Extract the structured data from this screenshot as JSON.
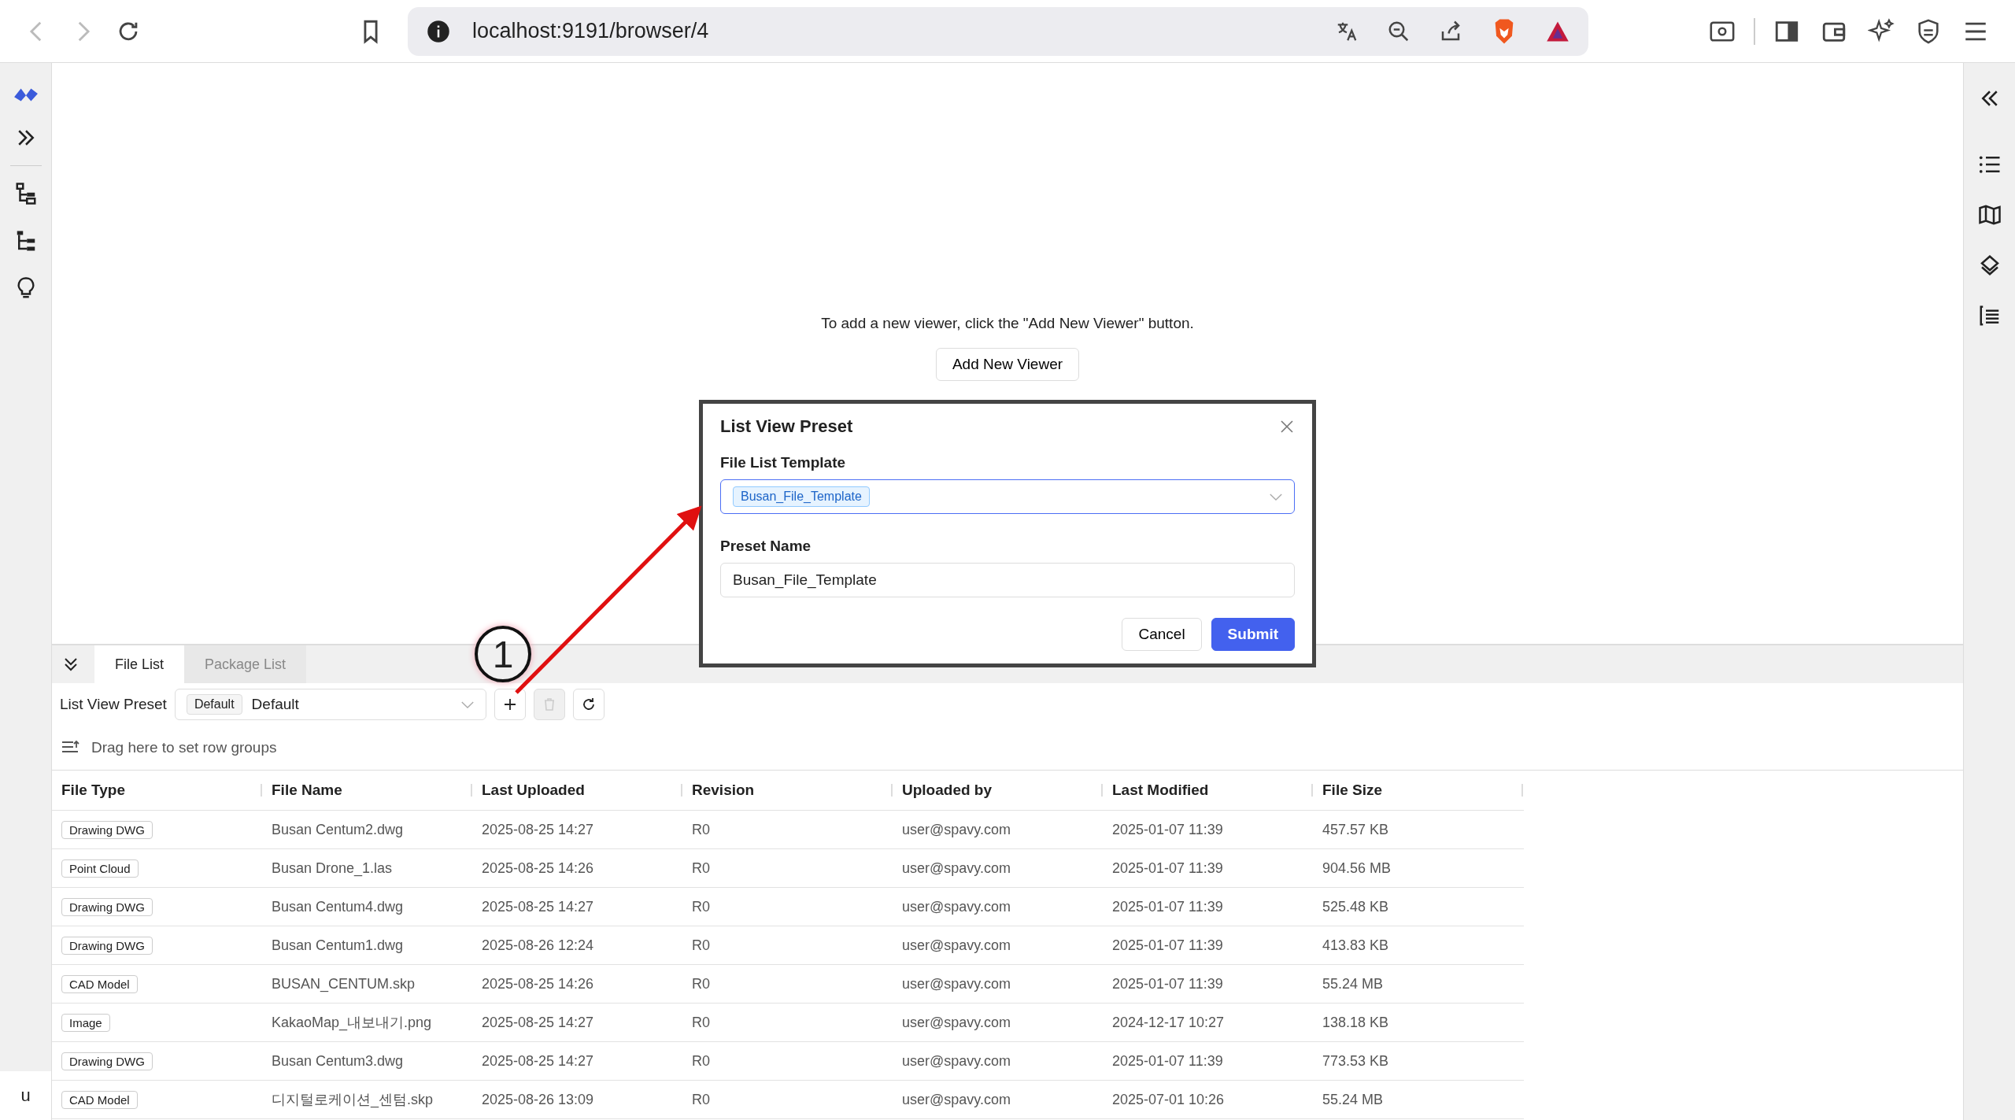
{
  "browser": {
    "url": "localhost:9191/browser/4"
  },
  "left_sidebar": {
    "footer": "u"
  },
  "viewer": {
    "message": "To add a new viewer, click the \"Add New Viewer\" button.",
    "button": "Add New Viewer"
  },
  "dialog": {
    "title": "List View Preset",
    "template_label": "File List Template",
    "template_tag": "Busan_File_Template",
    "preset_label": "Preset Name",
    "preset_value": "Busan_File_Template",
    "buttons": [
      {
        "label": "Cancel",
        "kind": "secondary"
      },
      {
        "label": "Submit",
        "kind": "primary"
      }
    ]
  },
  "tabs": [
    {
      "label": "File List",
      "selected": true
    },
    {
      "label": "Package List",
      "selected": false
    }
  ],
  "preset": {
    "label": "List View Preset",
    "tag": "Default",
    "value": "Default",
    "delete_disabled": true
  },
  "group_hint": "Drag here to set row groups",
  "table": {
    "columns": [
      "File Type",
      "File Name",
      "Last Uploaded",
      "Revision",
      "Uploaded by",
      "Last Modified",
      "File Size"
    ],
    "rows": [
      [
        "Drawing DWG",
        "Busan Centum2.dwg",
        "2025-08-25 14:27",
        "R0",
        "user@spavy.com",
        "2025-01-07 11:39",
        "457.57 KB"
      ],
      [
        "Point Cloud",
        "Busan Drone_1.las",
        "2025-08-25 14:26",
        "R0",
        "user@spavy.com",
        "2025-01-07 11:39",
        "904.56 MB"
      ],
      [
        "Drawing DWG",
        "Busan Centum4.dwg",
        "2025-08-25 14:27",
        "R0",
        "user@spavy.com",
        "2025-01-07 11:39",
        "525.48 KB"
      ],
      [
        "Drawing DWG",
        "Busan Centum1.dwg",
        "2025-08-26 12:24",
        "R0",
        "user@spavy.com",
        "2025-01-07 11:39",
        "413.83 KB"
      ],
      [
        "CAD Model",
        "BUSAN_CENTUM.skp",
        "2025-08-25 14:26",
        "R0",
        "user@spavy.com",
        "2025-01-07 11:39",
        "55.24 MB"
      ],
      [
        "Image",
        "KakaoMap_내보내기.png",
        "2025-08-25 14:27",
        "R0",
        "user@spavy.com",
        "2024-12-17 10:27",
        "138.18 KB"
      ],
      [
        "Drawing DWG",
        "Busan Centum3.dwg",
        "2025-08-25 14:27",
        "R0",
        "user@spavy.com",
        "2025-01-07 11:39",
        "773.53 KB"
      ],
      [
        "CAD Model",
        "디지털로케이션_센텀.skp",
        "2025-08-26 13:09",
        "R0",
        "user@spavy.com",
        "2025-07-01 10:26",
        "55.24 MB"
      ]
    ]
  },
  "annotation": {
    "label": "1"
  }
}
